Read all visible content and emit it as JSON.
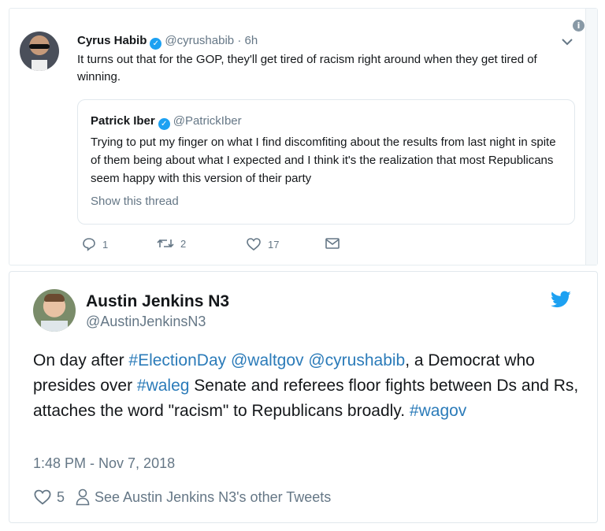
{
  "screenshot_tweet": {
    "author_name": "Cyrus Habib",
    "author_handle": "@cyrushabib",
    "separator": "·",
    "time_ago": "6h",
    "text": "It turns out that for the GOP, they'll get tired of racism right around when they get tired of winning.",
    "quoted": {
      "author_name": "Patrick Iber",
      "author_handle": "@PatrickIber",
      "text": "Trying to put my finger on what I find discomfiting about the results from last night in spite of them being about what I expected and I think it's the realization that most Republicans seem happy with this version of their party",
      "show_thread": "Show this thread"
    },
    "replies": "1",
    "retweets": "2",
    "likes": "17"
  },
  "embedded_tweet": {
    "author_name": "Austin Jenkins N3",
    "author_handle": "@AustinJenkinsN3",
    "text_parts": {
      "p1": "On day after ",
      "hashtag_election": "#ElectionDay",
      "p2": " ",
      "mention_waltgov": "@waltgov",
      "p3": " ",
      "mention_cyrus": "@cyrushabib",
      "p4": ", a Democrat who presides over ",
      "hashtag_waleg": "#waleg",
      "p5": " Senate and referees floor fights between Ds and Rs, attaches the word \"racism\" to Republicans broadly. ",
      "hashtag_wagov": "#wagov"
    },
    "timestamp": "1:48 PM - Nov 7, 2018",
    "likes": "5",
    "other_tweets_link": "See Austin Jenkins N3's other Tweets"
  },
  "colors": {
    "link": "#2b7bb9",
    "twitter_blue": "#1da1f2",
    "muted": "#657786"
  },
  "icons": [
    "info-icon",
    "chevron-down-icon",
    "verified-icon",
    "reply-icon",
    "retweet-icon",
    "heart-icon",
    "mail-icon",
    "twitter-bird-icon",
    "person-icon"
  ]
}
